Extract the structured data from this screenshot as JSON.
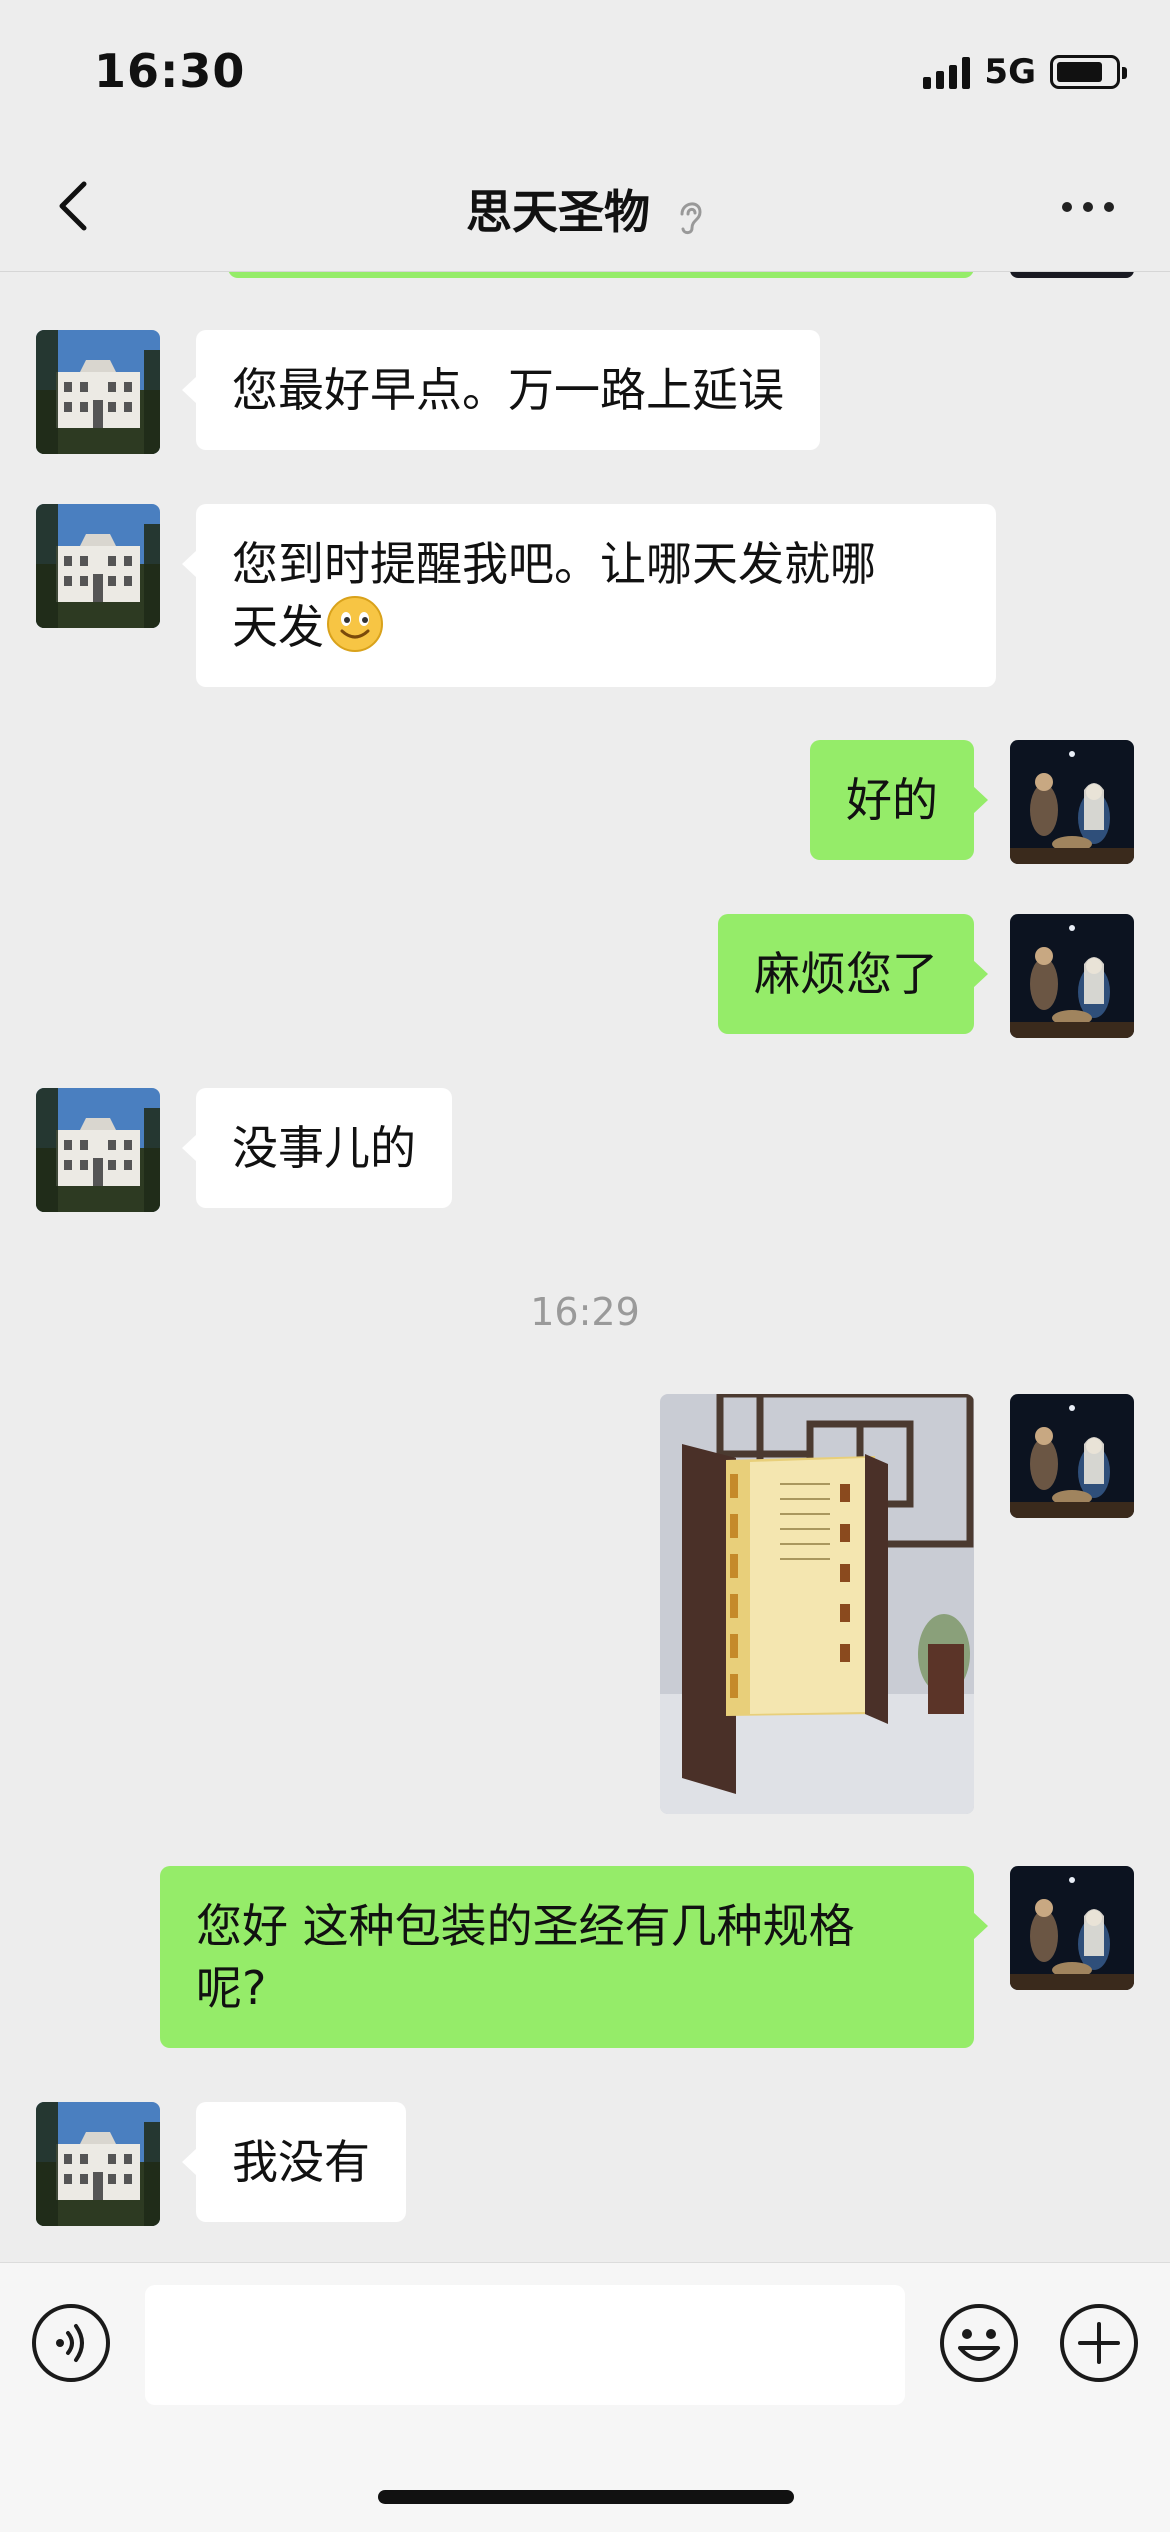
{
  "status_bar": {
    "time": "16:30",
    "network": "5G"
  },
  "header": {
    "title": "思天圣物"
  },
  "messages": [
    {
      "side": "in",
      "text": "您最好早点。万一路上延误"
    },
    {
      "side": "in",
      "text_line1": "您到时提醒我吧。让哪天发就哪",
      "text_line2": "天发"
    },
    {
      "side": "out",
      "text": "好的"
    },
    {
      "side": "out",
      "text": "麻烦您了"
    },
    {
      "side": "in",
      "text": "没事儿的"
    },
    {
      "side": "out",
      "text_line1": "您好 这种包装的圣经有几种规格",
      "text_line2": "呢?"
    },
    {
      "side": "in",
      "text": "我没有"
    }
  ],
  "timestamp": "16:29",
  "colors": {
    "outgoing_bubble": "#95ec69",
    "incoming_bubble": "#ffffff",
    "background": "#ededed"
  }
}
